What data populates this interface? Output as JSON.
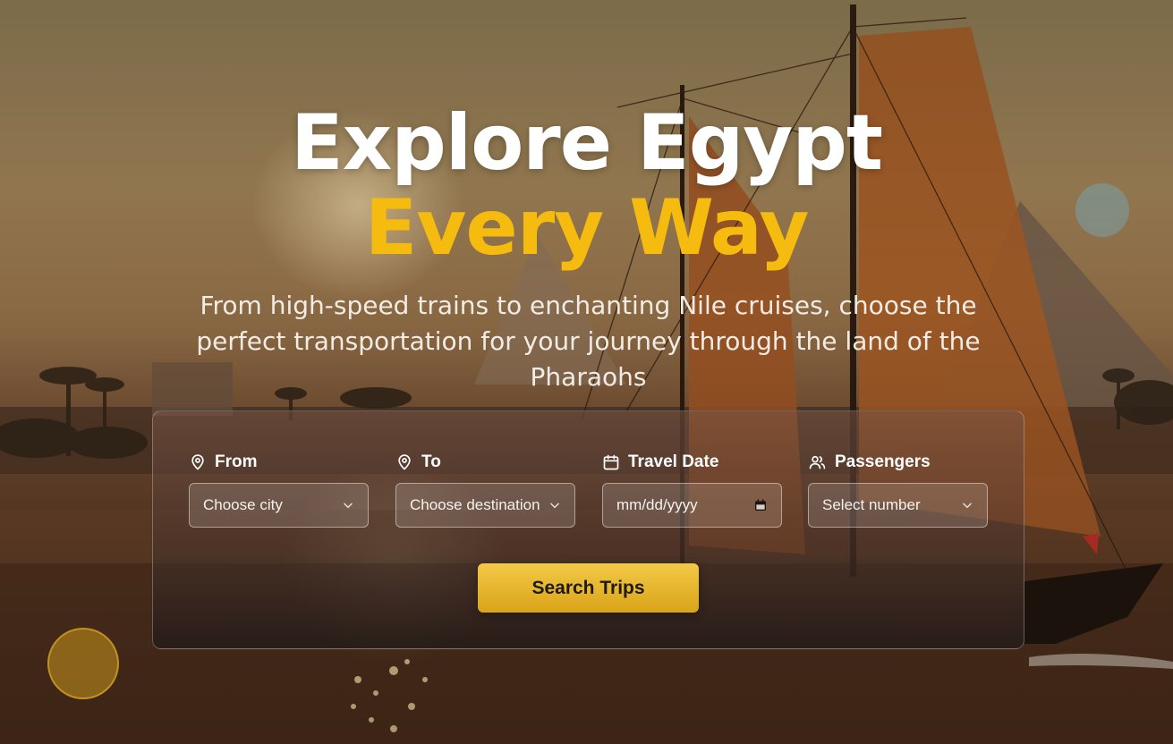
{
  "hero": {
    "title_line1": "Explore Egypt",
    "title_line2": "Every Way",
    "subtitle": "From high-speed trains to enchanting Nile cruises, choose the perfect transportation for your journey through the land of the Pharaohs",
    "accent_color": "#f5bb0f"
  },
  "search": {
    "from": {
      "label": "From",
      "placeholder": "Choose city",
      "icon": "map-pin-icon"
    },
    "to": {
      "label": "To",
      "placeholder": "Choose destination",
      "icon": "map-pin-icon"
    },
    "date": {
      "label": "Travel Date",
      "placeholder": "mm/dd/yyyy",
      "icon": "calendar-icon"
    },
    "passengers": {
      "label": "Passengers",
      "placeholder": "Select number",
      "icon": "users-icon"
    },
    "button_label": "Search Trips",
    "button_color": "#e6b52c"
  }
}
